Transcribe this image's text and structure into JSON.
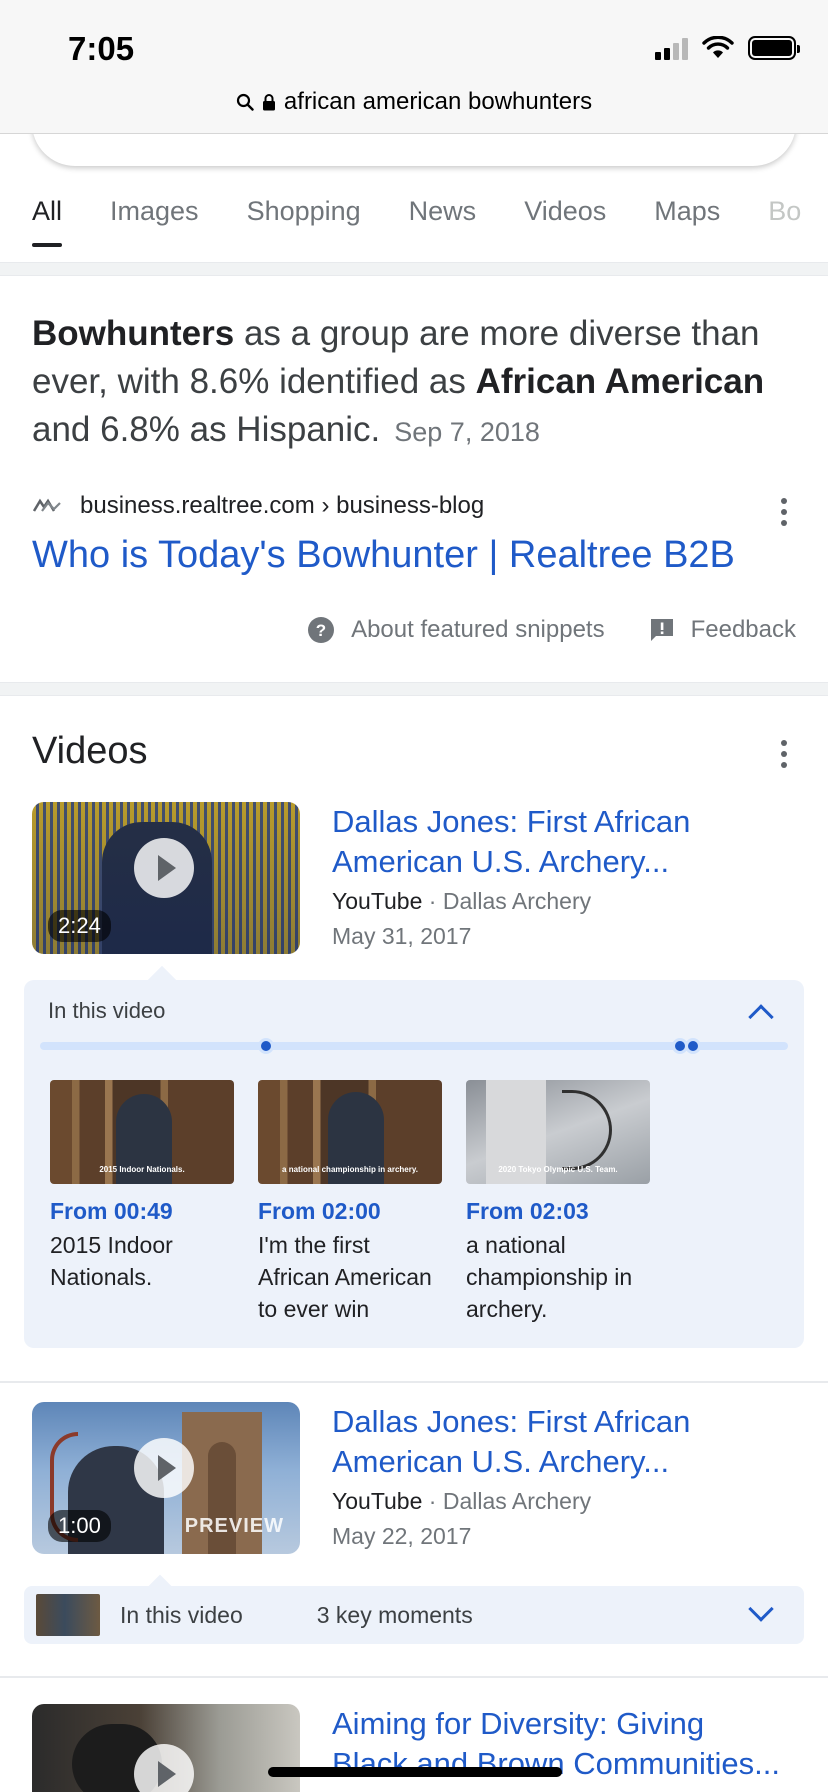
{
  "status_bar": {
    "time": "7:05"
  },
  "url_bar": {
    "text": "african american bowhunters"
  },
  "tabs": [
    {
      "label": "All",
      "active": true
    },
    {
      "label": "Images"
    },
    {
      "label": "Shopping"
    },
    {
      "label": "News"
    },
    {
      "label": "Videos"
    },
    {
      "label": "Maps"
    },
    {
      "label": "Bo"
    }
  ],
  "snippet": {
    "text_parts": [
      "Bowhunters",
      " as a group are more diverse than ever, with 8.6% identified as ",
      "African American",
      " and 6.8% as Hispanic."
    ],
    "date": "Sep 7, 2018",
    "source": "business.realtree.com › business-blog",
    "title": "Who is Today's Bowhunter | Realtree B2B",
    "about_label": "About featured snippets",
    "feedback_label": "Feedback"
  },
  "videos": {
    "heading": "Videos",
    "items": [
      {
        "title_line1": "Dallas Jones: First African",
        "title_line2": "American U.S. Archery...",
        "platform": "YouTube",
        "channel": "· Dallas Archery",
        "date": "May 31, 2017",
        "duration": "2:24",
        "key_moments": {
          "label": "In this video",
          "moments": [
            {
              "from": "From 00:49",
              "desc": [
                "2015 Indoor",
                "Nationals."
              ],
              "caption": "2015 Indoor Nationals."
            },
            {
              "from": "From 02:00",
              "desc": [
                "I'm the first",
                "African American",
                "to ever win"
              ],
              "caption": "a national championship in archery."
            },
            {
              "from": "From 02:03",
              "desc": [
                "a national",
                "championship in",
                "archery."
              ],
              "caption": "2020 Tokyo Olympic U.S. Team."
            }
          ]
        }
      },
      {
        "title_line1": "Dallas Jones: First African",
        "title_line2": "American U.S. Archery...",
        "platform": "YouTube",
        "channel": "· Dallas Archery",
        "date": "May 22, 2017",
        "duration": "1:00",
        "preview": "PREVIEW",
        "key_moments": {
          "label": "In this video",
          "count": "3 key moments"
        }
      },
      {
        "title_line1": "Aiming for Diversity: Giving",
        "title_line2": "Black and Brown Communities..."
      }
    ]
  }
}
